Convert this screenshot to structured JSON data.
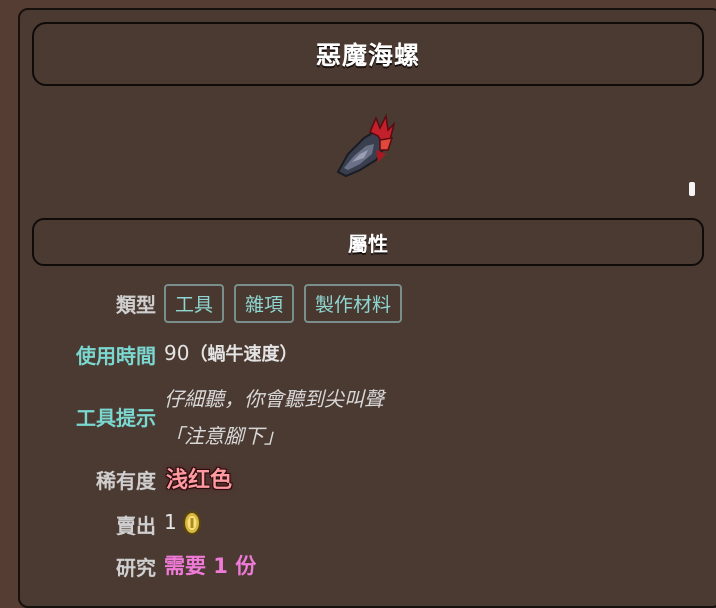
{
  "item": {
    "name": "惡魔海螺",
    "icon": "demon-conch-icon"
  },
  "section": {
    "title": "屬性"
  },
  "properties": {
    "type_label": "類型",
    "type_tags": [
      "工具",
      "雜項",
      "製作材料"
    ],
    "use_time_label": "使用時間",
    "use_time_value": "90",
    "use_time_speed": "（蝸牛速度）",
    "tooltip_label": "工具提示",
    "tooltip_lines": [
      "仔細聽，你會聽到尖叫聲",
      "「注意腳下」"
    ],
    "rarity_label": "稀有度",
    "rarity_value": "浅红色",
    "sell_label": "賣出",
    "sell_value": "1",
    "sell_icon": "gold-coin-icon",
    "research_label": "研究",
    "research_value": "需要 1 份"
  },
  "colors": {
    "background": "#553d33",
    "label_teal": "#7ad8d0",
    "rarity": "#ff9aa0",
    "research": "#f07ad8"
  }
}
